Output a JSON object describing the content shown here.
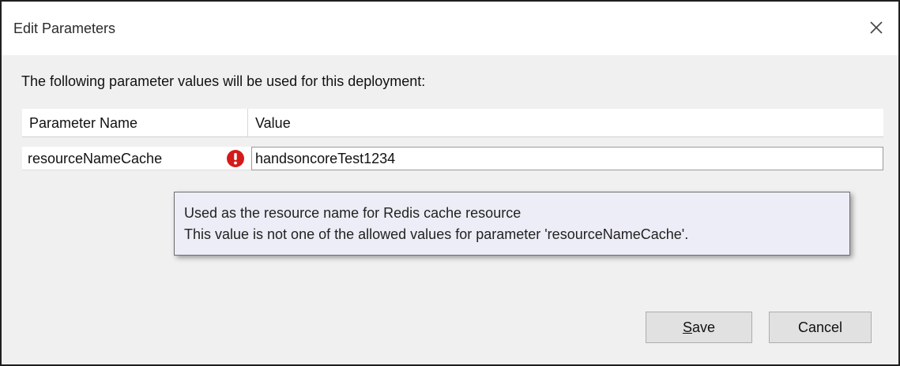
{
  "window": {
    "title": "Edit Parameters",
    "close_icon": "close-icon"
  },
  "content": {
    "intro": "The following parameter values will be used for this deployment:"
  },
  "grid": {
    "columns": [
      "Parameter Name",
      "Value"
    ],
    "rows": [
      {
        "name": "resourceNameCache",
        "value": "handsoncoreTest1234",
        "status_icon": "error-icon",
        "status_color": "#d41a1a"
      }
    ]
  },
  "tooltip": {
    "line1": "Used as the resource name for Redis cache resource",
    "line2": "This value is not one of the allowed values for parameter 'resourceNameCache'."
  },
  "buttons": {
    "save_mnemonic": "S",
    "save_rest": "ave",
    "cancel": "Cancel"
  }
}
